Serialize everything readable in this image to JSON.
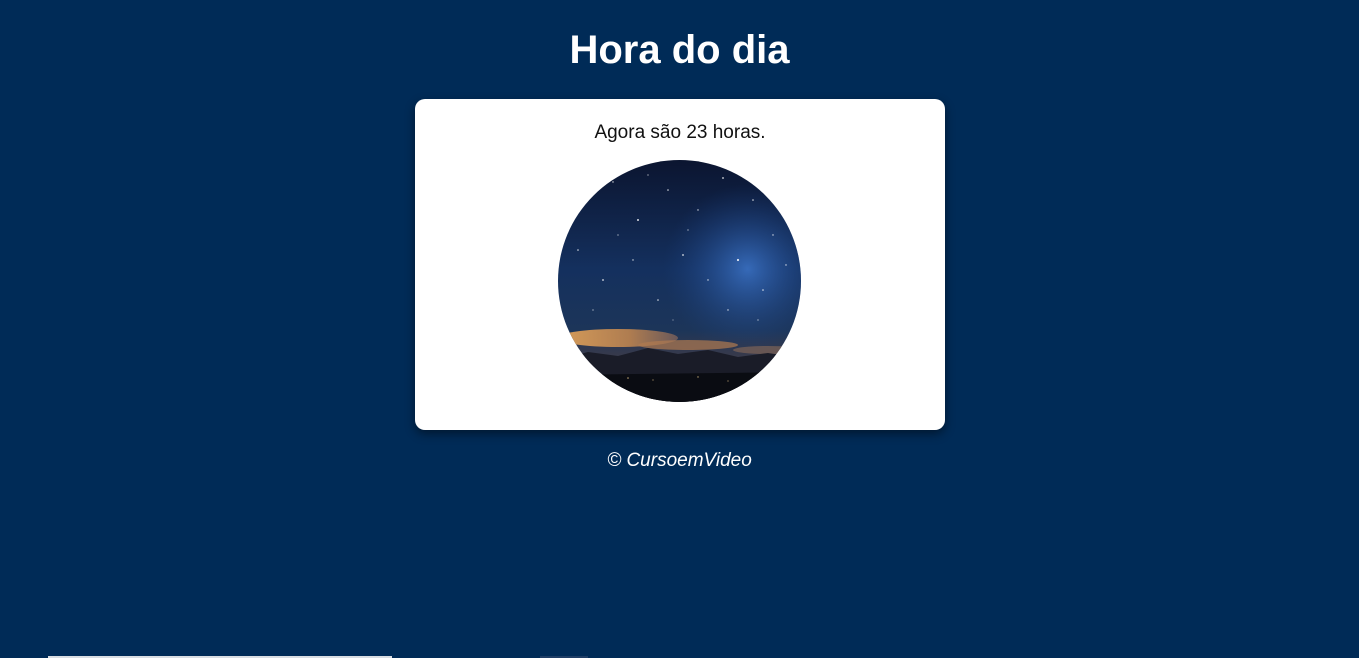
{
  "page": {
    "title": "Hora do dia",
    "background_color": "#002b57"
  },
  "card": {
    "message": "Agora são 23 horas.",
    "image": {
      "name": "night-sky-photo",
      "depicts": "starry night sky over dark mountains with orange clouds on horizon",
      "shape": "circle"
    }
  },
  "footer": {
    "text": "© CursoemVideo"
  }
}
